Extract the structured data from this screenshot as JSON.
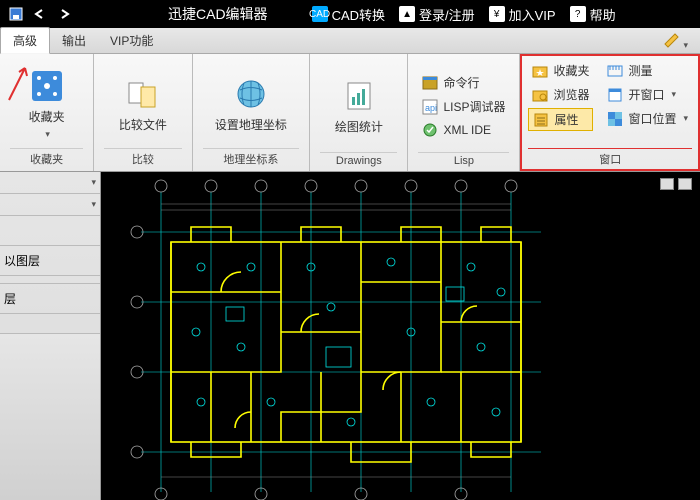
{
  "titlebar": {
    "app_title": "迅捷CAD编辑器",
    "convert": "CAD转换",
    "login": "登录/注册",
    "vip": "加入VIP",
    "help": "帮助"
  },
  "tabs": {
    "advanced": "高级",
    "output": "输出",
    "vip_fn": "VIP功能"
  },
  "ribbon": {
    "favorites": {
      "btn": "收藏夹",
      "group": "收藏夹"
    },
    "compare": {
      "btn": "比较文件",
      "group": "比较"
    },
    "geo": {
      "btn": "设置地理坐标",
      "group": "地理坐标系"
    },
    "drawings": {
      "btn": "绘图统计",
      "group": "Drawings"
    },
    "lisp": {
      "cmd": "命令行",
      "debugger": "LISP调试器",
      "xml": "XML IDE",
      "group": "Lisp"
    },
    "window": {
      "favorites": "收藏夹",
      "browser": "浏览器",
      "properties": "属性",
      "measure": "测量",
      "openwin": "开窗口",
      "winpos": "窗口位置",
      "group": "窗口"
    }
  },
  "side": {
    "bylayer": "以图层",
    "layer": "层"
  }
}
